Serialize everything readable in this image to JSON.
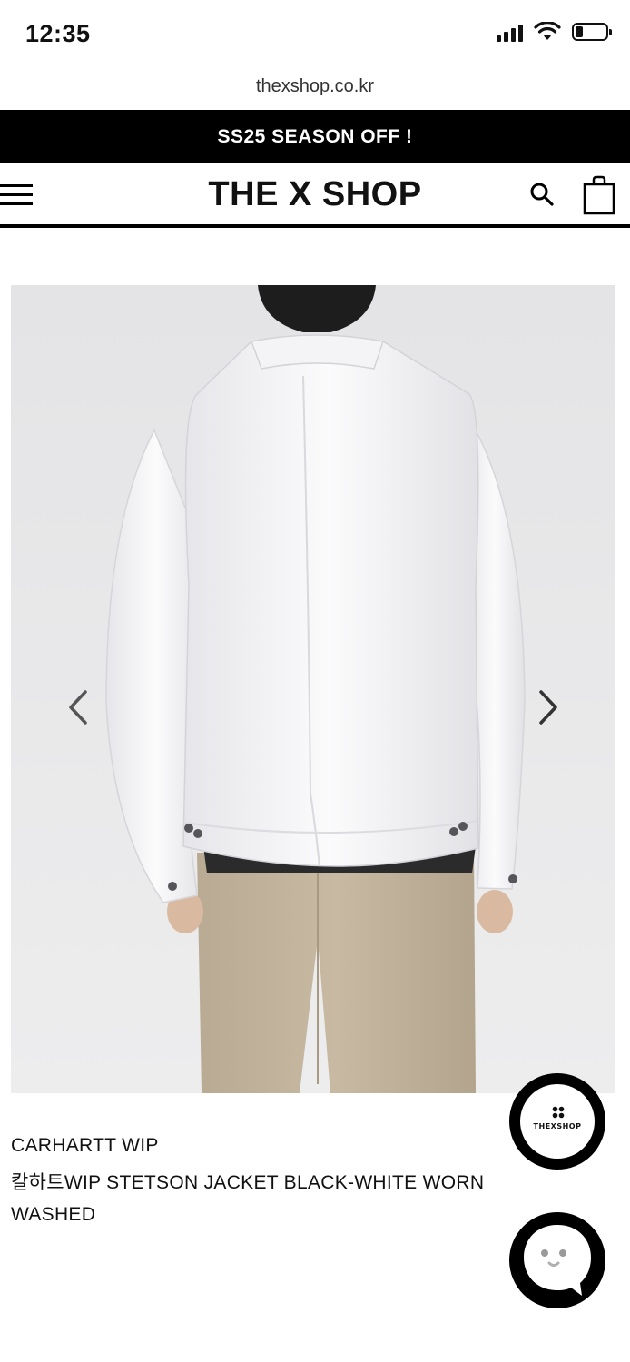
{
  "status_bar": {
    "time": "12:35",
    "icons": [
      "signal-icon",
      "wifi-icon",
      "battery-icon"
    ]
  },
  "browser": {
    "url": "thexshop.co.kr"
  },
  "promo": {
    "text": "SS25 SEASON OFF !"
  },
  "header": {
    "logo": "THE X SHOP",
    "icons": [
      "menu-icon",
      "search-icon",
      "shopping-bag-icon"
    ]
  },
  "product": {
    "image": "product-photo-white-jacket-back",
    "brand": "CARHARTT WIP",
    "name": "칼하트WIP STETSON JACKET BLACK-WHITE WORN WASHED"
  },
  "floating": {
    "shop_badge_text": "THEXSHOP",
    "chat_icon": "chat-bubble-icon"
  },
  "colors": {
    "banner_bg": "#000000",
    "banner_text": "#ffffff",
    "image_bg": "#ececec"
  }
}
